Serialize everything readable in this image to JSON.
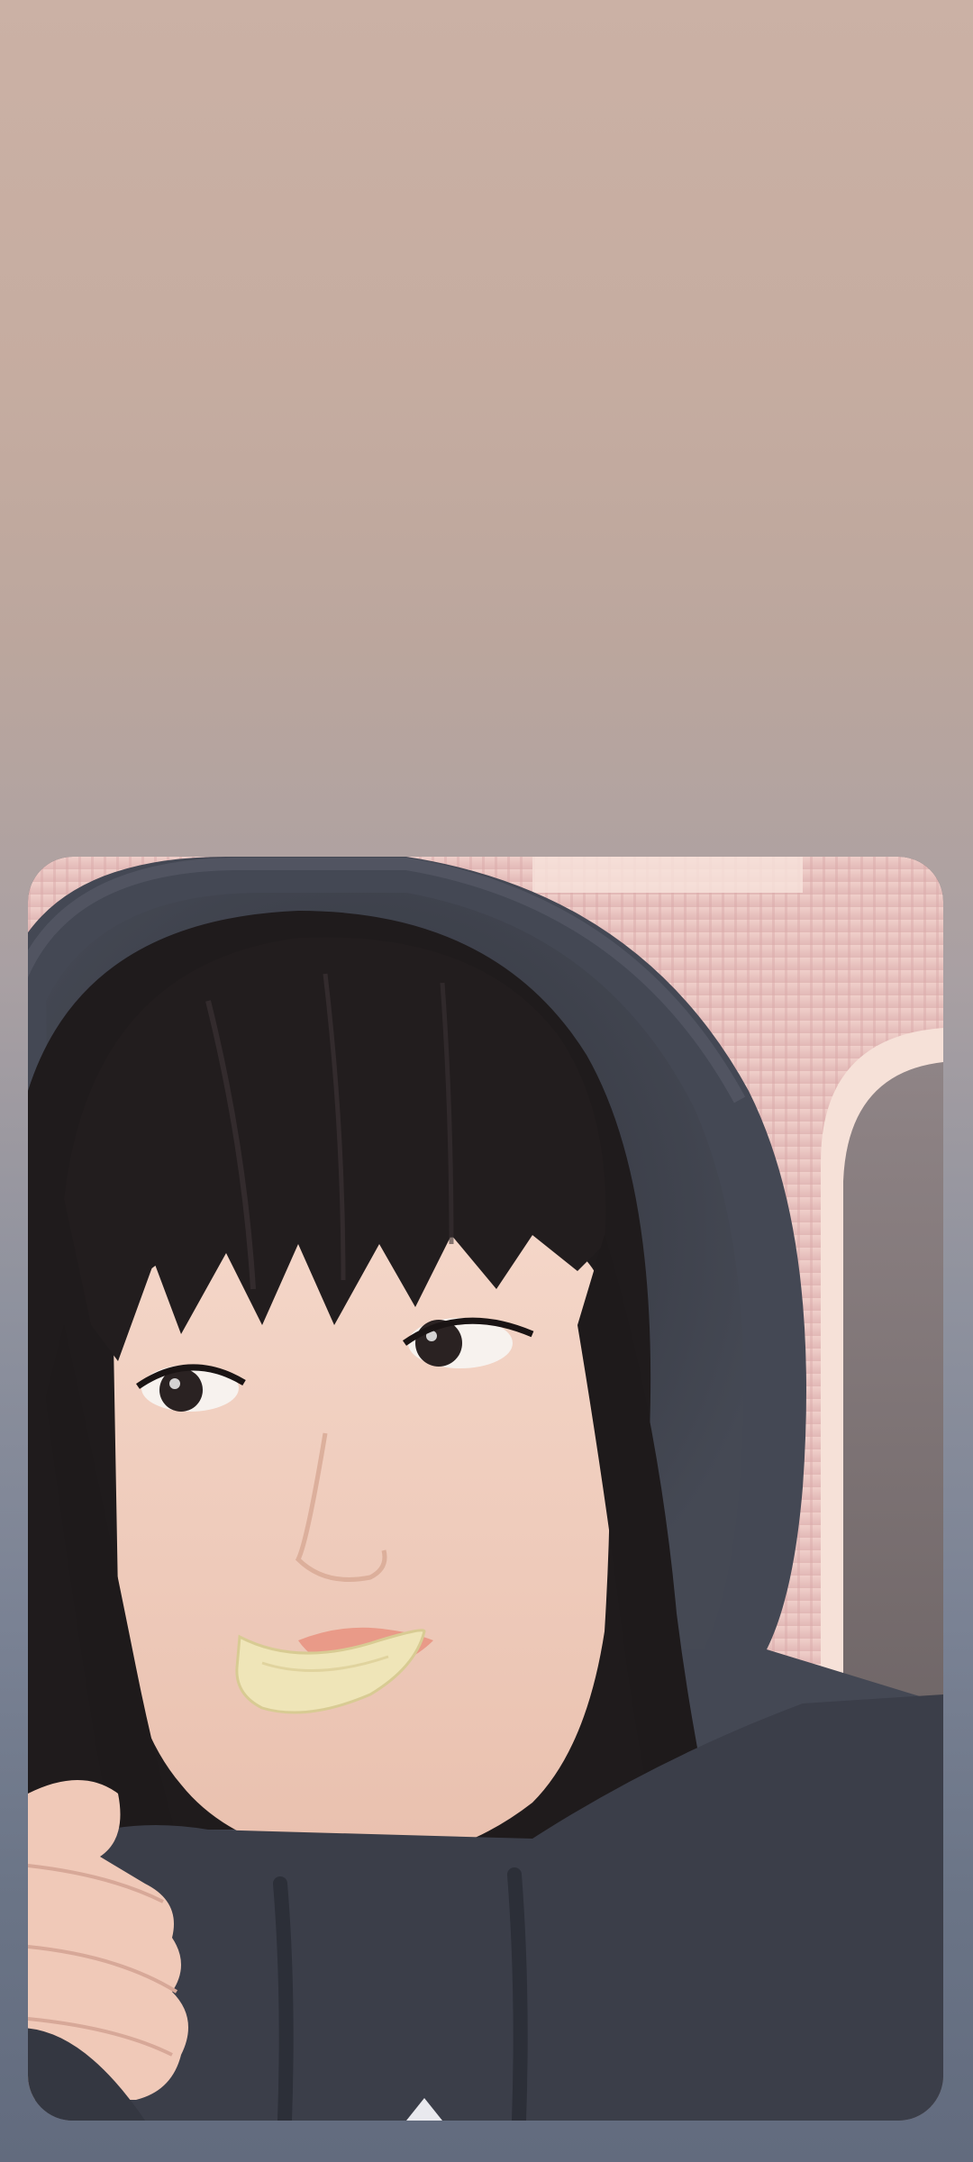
{
  "screen": {
    "type": "story-photo-viewer"
  },
  "photo": {
    "subject": "selfie-photo",
    "colors": {
      "background_top": "#cbb1a5",
      "background_bottom": "#626b7e",
      "wall": "#e8c3c0",
      "hoodie": "#3b3e49",
      "hair": "#1f1b1c",
      "skin": "#f1cdbd",
      "chip": "#efe5b8"
    }
  }
}
